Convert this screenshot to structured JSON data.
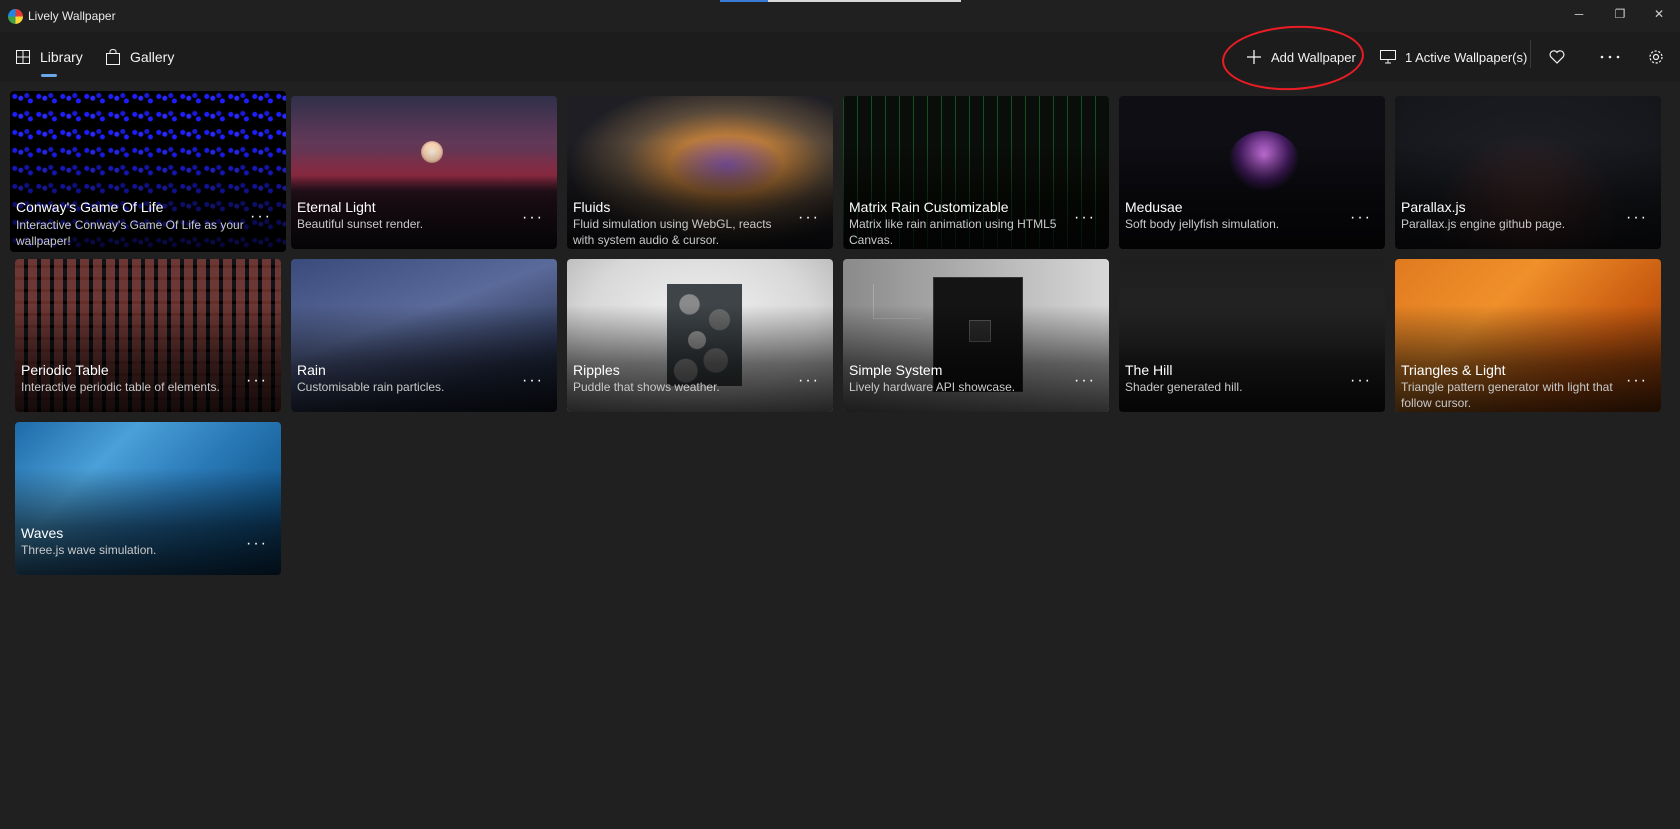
{
  "window": {
    "title": "Lively Wallpaper",
    "controls": {
      "minimize": "─",
      "maximize": "❐",
      "close": "✕"
    }
  },
  "nav": {
    "tabs": [
      {
        "label": "Library",
        "icon": "grid-icon",
        "selected": true
      },
      {
        "label": "Gallery",
        "icon": "bag-icon",
        "selected": false
      }
    ],
    "add_wallpaper_label": "Add Wallpaper",
    "active_wallpapers_label": "1 Active Wallpaper(s)",
    "icons": {
      "heart": "heart-icon",
      "more": "more-icon",
      "settings": "gear-icon",
      "monitor": "monitor-icon",
      "plus": "plus-icon"
    },
    "annotation_color": "#ec1c24",
    "accent": "#69a7e6"
  },
  "library": {
    "cards": [
      {
        "title": "Conway's Game Of Life",
        "description": "Interactive Conway's Game Of Life as your wallpaper!",
        "more": "···"
      },
      {
        "title": "Eternal Light",
        "description": "Beautiful sunset render.",
        "more": "···"
      },
      {
        "title": "Fluids",
        "description": "Fluid simulation using WebGL, reacts with system audio & cursor.",
        "more": "···"
      },
      {
        "title": "Matrix Rain Customizable",
        "description": "Matrix like rain animation using HTML5 Canvas.",
        "more": "···"
      },
      {
        "title": "Medusae",
        "description": "Soft body jellyfish simulation.",
        "more": "···"
      },
      {
        "title": "Parallax.js",
        "description": "Parallax.js engine github page.",
        "more": "···"
      },
      {
        "title": "Periodic Table",
        "description": "Interactive periodic table of elements.",
        "more": "···"
      },
      {
        "title": "Rain",
        "description": "Customisable rain particles.",
        "more": "···"
      },
      {
        "title": "Ripples",
        "description": "Puddle that shows weather.",
        "more": "···"
      },
      {
        "title": "Simple System",
        "description": "Lively hardware API showcase.",
        "more": "···"
      },
      {
        "title": "The Hill",
        "description": "Shader generated hill.",
        "more": "···"
      },
      {
        "title": "Triangles & Light",
        "description": "Triangle pattern generator with light that follow cursor.",
        "more": "···"
      },
      {
        "title": "Waves",
        "description": "Three.js wave simulation.",
        "more": "···"
      }
    ]
  }
}
